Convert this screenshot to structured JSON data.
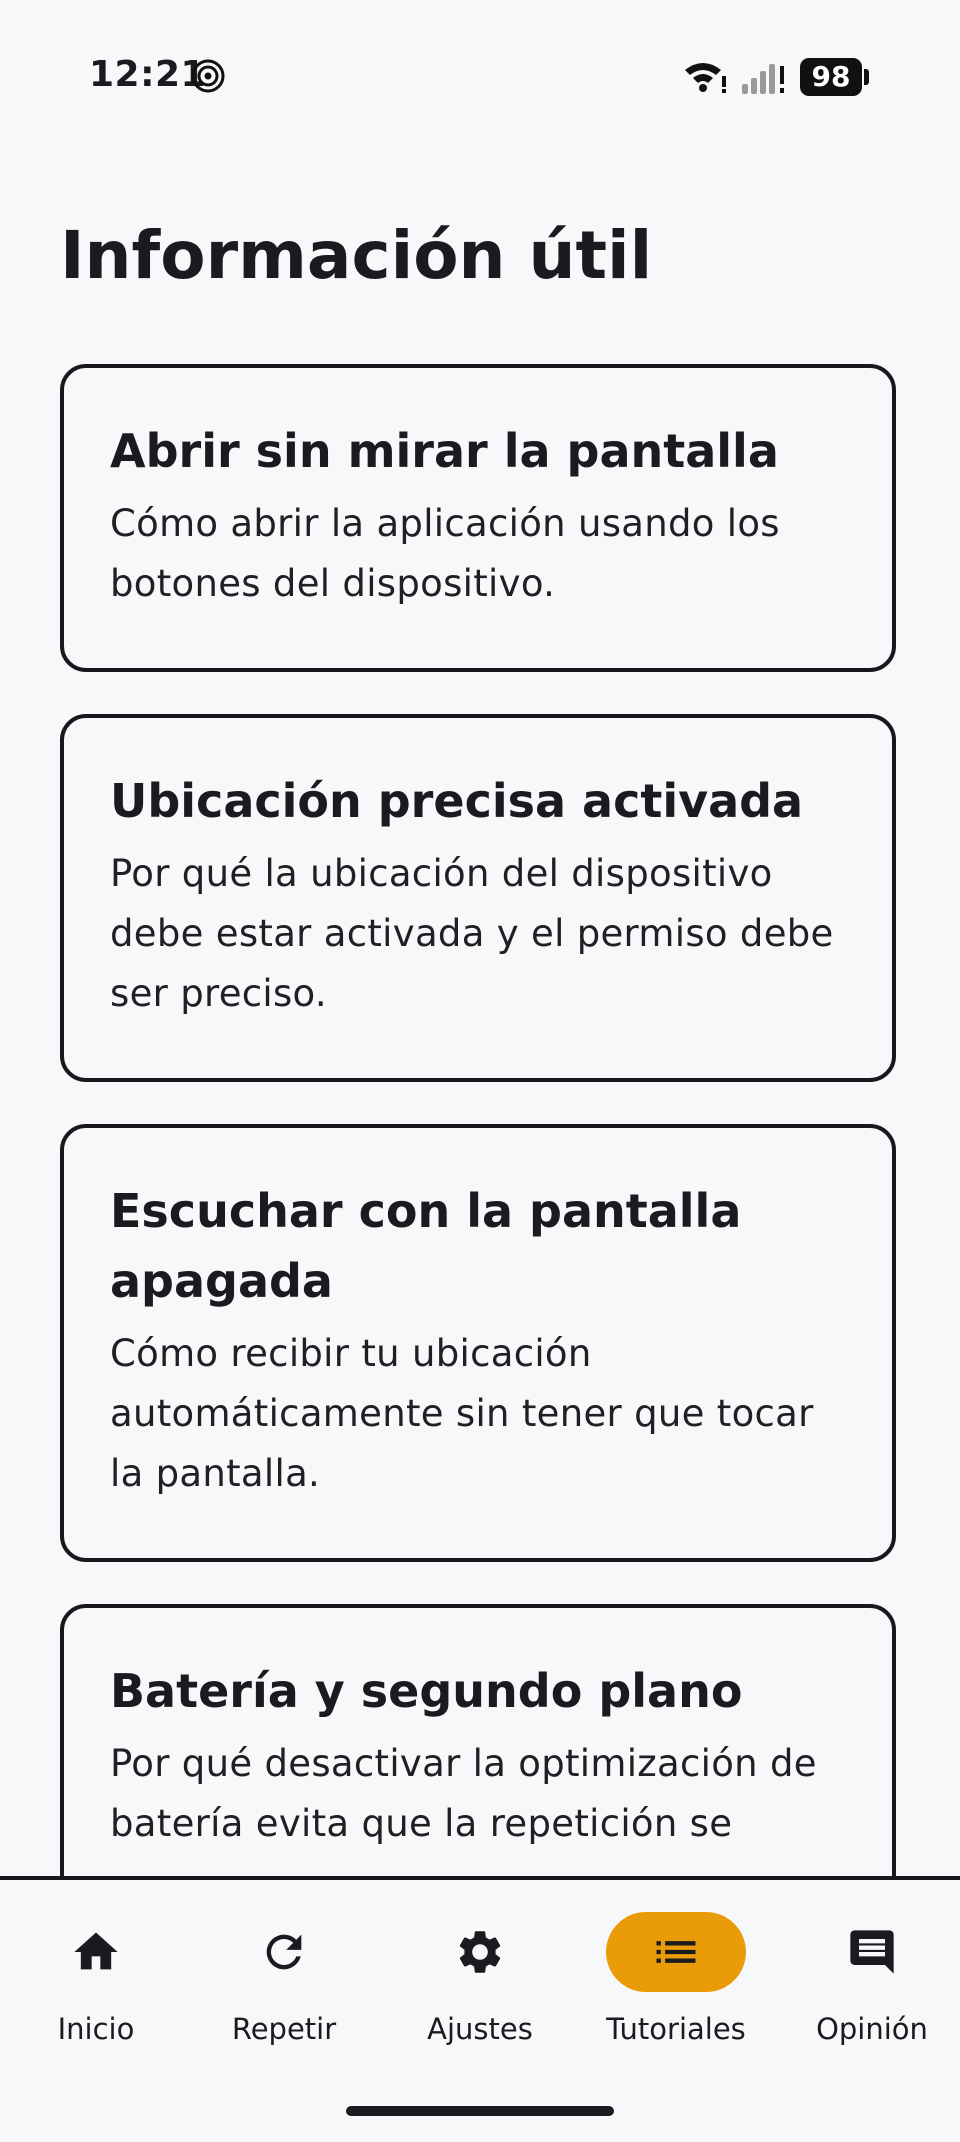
{
  "status_bar": {
    "time": "12:21",
    "battery_level": "98",
    "icons": [
      "spiral-icon",
      "wifi-icon",
      "signal-icon",
      "battery-icon"
    ]
  },
  "page": {
    "title": "Información útil"
  },
  "cards": [
    {
      "title": "Abrir sin mirar la pantalla",
      "description": "Cómo abrir la aplicación usando los botones del dispositivo."
    },
    {
      "title": "Ubicación precisa activada",
      "description": "Por qué la ubicación del dispositivo debe estar activada y el permiso debe ser preciso."
    },
    {
      "title": "Escuchar con la pantalla apagada",
      "description": "Cómo recibir tu ubicación automáticamente sin tener que tocar la pantalla."
    },
    {
      "title": "Batería y segundo plano",
      "description": "Por qué desactivar la optimización de batería evita que la repetición se"
    }
  ],
  "nav": {
    "items": [
      {
        "label": "Inicio",
        "icon": "home-icon"
      },
      {
        "label": "Repetir",
        "icon": "refresh-icon"
      },
      {
        "label": "Ajustes",
        "icon": "gear-icon"
      },
      {
        "label": "Tutoriales",
        "icon": "list-icon",
        "active": true
      },
      {
        "label": "Opinión",
        "icon": "feedback-icon"
      }
    ],
    "active_color": "#e99c07"
  }
}
